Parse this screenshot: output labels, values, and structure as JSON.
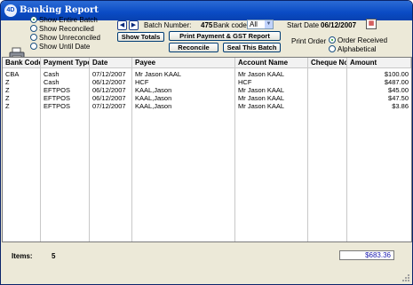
{
  "window": {
    "title": "Banking Report",
    "app_icon": "4D"
  },
  "filters": {
    "options": [
      {
        "label": "Show Entire Batch",
        "selected": true
      },
      {
        "label": "Show Reconciled",
        "selected": false
      },
      {
        "label": "Show Unreconciled",
        "selected": false
      },
      {
        "label": "Show Until Date",
        "selected": false
      }
    ]
  },
  "batch": {
    "label": "Batch Number:",
    "number": "475",
    "bank_code_label": "Bank code:",
    "bank_code_value": "All"
  },
  "buttons": {
    "show_totals": "Show Totals",
    "print_report": "Print Payment & GST Report",
    "reconcile": "Reconcile",
    "seal_batch": "Seal This Batch",
    "prev": "◀",
    "next": "▶"
  },
  "start_date": {
    "label": "Start Date",
    "value": "06/12/2007"
  },
  "print_order": {
    "label": "Print Order",
    "options": [
      {
        "label": "Order Received",
        "selected": true
      },
      {
        "label": "Alphabetical",
        "selected": false
      }
    ]
  },
  "table": {
    "columns": [
      "Bank Code",
      "Payment Type",
      "Date",
      "Payee",
      "Account Name",
      "Cheque No",
      "Amount"
    ],
    "rows": [
      {
        "bank_code": "CBA",
        "payment_type": "Cash",
        "date": "07/12/2007",
        "payee": "Mr Jason KAAL",
        "account_name": "Mr Jason KAAL",
        "cheque_no": "",
        "amount": "$100.00"
      },
      {
        "bank_code": "Z",
        "payment_type": "Cash",
        "date": "06/12/2007",
        "payee": "HCF",
        "account_name": "HCF",
        "cheque_no": "",
        "amount": "$487.00"
      },
      {
        "bank_code": "Z",
        "payment_type": "EFTPOS",
        "date": "06/12/2007",
        "payee": "KAAL,Jason",
        "account_name": "Mr Jason KAAL",
        "cheque_no": "",
        "amount": "$45.00"
      },
      {
        "bank_code": "Z",
        "payment_type": "EFTPOS",
        "date": "06/12/2007",
        "payee": "KAAL,Jason",
        "account_name": "Mr Jason KAAL",
        "cheque_no": "",
        "amount": "$47.50"
      },
      {
        "bank_code": "Z",
        "payment_type": "EFTPOS",
        "date": "07/12/2007",
        "payee": "KAAL,Jason",
        "account_name": "Mr Jason KAAL",
        "cheque_no": "",
        "amount": "$3.86"
      }
    ]
  },
  "footer": {
    "items_label": "Items:",
    "items_count": "5",
    "total": "$683.36"
  },
  "icons": {
    "printer": "printer-icon",
    "calendar": "calendar-icon"
  },
  "colors": {
    "title_bar": "#0a4bc4",
    "total_text": "#1a1ab0"
  }
}
